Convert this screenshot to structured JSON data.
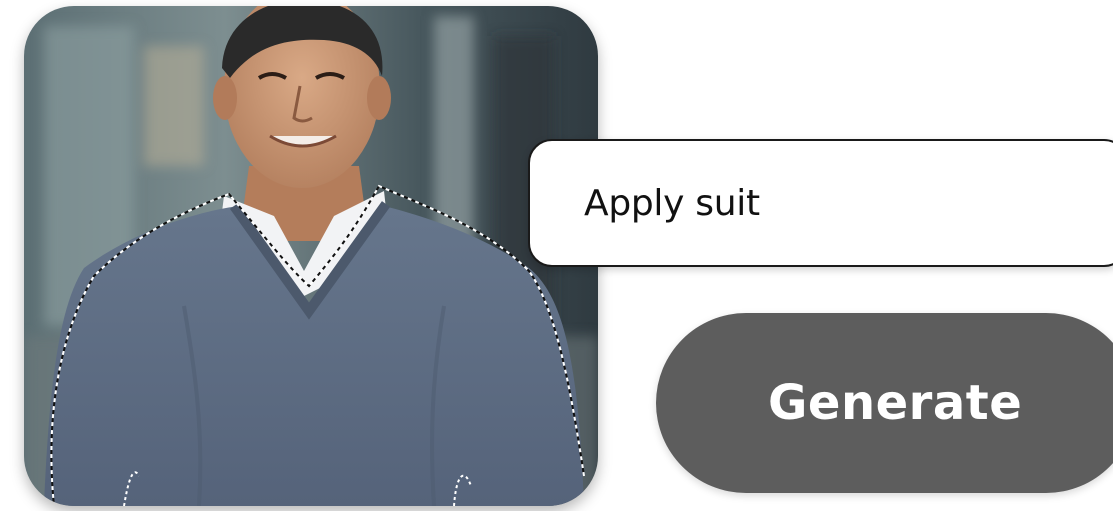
{
  "prompt": {
    "value": "Apply suit"
  },
  "actions": {
    "generate_label": "Generate"
  },
  "photo": {
    "subject": "smiling man in grey v-neck sweater over white collared shirt",
    "selection": "dotted marching-ants outline around torso"
  },
  "colors": {
    "button_bg": "#5d5d5d",
    "button_text": "#ffffff",
    "field_border": "#1a1a1a",
    "sweater": "#5f6f86"
  }
}
